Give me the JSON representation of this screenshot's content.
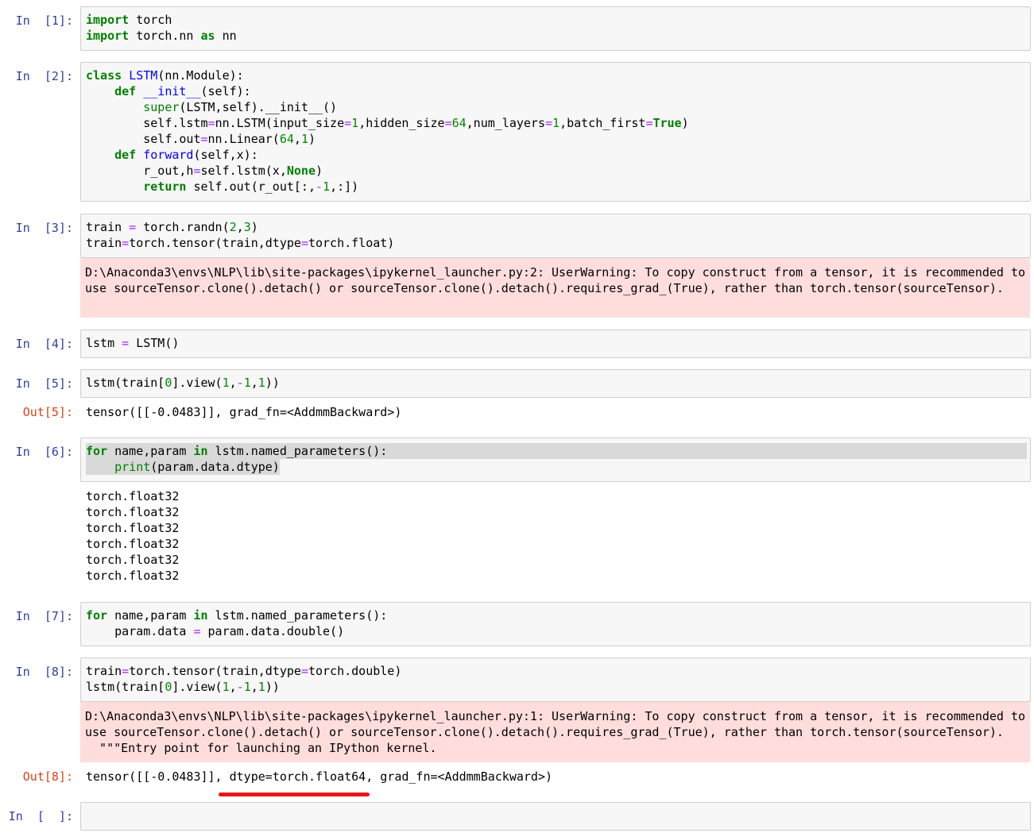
{
  "cells": [
    {
      "prompt": "In  [1]:",
      "lines": [
        "import torch",
        "import torch.nn as nn"
      ]
    },
    {
      "prompt": "In  [2]:",
      "lines": [
        "class LSTM(nn.Module):",
        "    def __init__(self):",
        "        super(LSTM,self).__init__()",
        "        self.lstm=nn.LSTM(input_size=1,hidden_size=64,num_layers=1,batch_first=True)",
        "        self.out=nn.Linear(64,1)",
        "    def forward(self,x):",
        "        r_out,h=self.lstm(x,None)",
        "        return self.out(r_out[:,-1,:])"
      ]
    },
    {
      "prompt": "In  [3]:",
      "lines": [
        "train = torch.randn(2,3)",
        "train=torch.tensor(train,dtype=torch.float)"
      ],
      "stderr": "D:\\Anaconda3\\envs\\NLP\\lib\\site-packages\\ipykernel_launcher.py:2: UserWarning: To copy construct from a tensor, it is recommended to\nuse sourceTensor.clone().detach() or sourceTensor.clone().detach().requires_grad_(True), rather than torch.tensor(sourceTensor)."
    },
    {
      "prompt": "In  [4]:",
      "lines": [
        "lstm = LSTM()"
      ]
    },
    {
      "prompt": "In  [5]:",
      "lines": [
        "lstm(train[0].view(1,-1,1))"
      ],
      "out_prompt": "Out[5]:",
      "out": "tensor([[-0.0483]], grad_fn=<AddmmBackward>)"
    },
    {
      "prompt": "In  [6]:",
      "lines": [
        "for name,param in lstm.named_parameters():",
        "    print(param.data.dtype)"
      ],
      "stdout": "torch.float32\ntorch.float32\ntorch.float32\ntorch.float32\ntorch.float32\ntorch.float32"
    },
    {
      "prompt": "In  [7]:",
      "lines": [
        "for name,param in lstm.named_parameters():",
        "    param.data = param.data.double()"
      ]
    },
    {
      "prompt": "In  [8]:",
      "lines": [
        "train=torch.tensor(train,dtype=torch.double)",
        "lstm(train[0].view(1,-1,1))"
      ],
      "stderr": "D:\\Anaconda3\\envs\\NLP\\lib\\site-packages\\ipykernel_launcher.py:1: UserWarning: To copy construct from a tensor, it is recommended to\nuse sourceTensor.clone().detach() or sourceTensor.clone().detach().requires_grad_(True), rather than torch.tensor(sourceTensor).\n  \"\"\"Entry point for launching an IPython kernel.",
      "out_prompt": "Out[8]:",
      "out": "tensor([[-0.0483]], dtype=torch.float64, grad_fn=<AddmmBackward>)"
    },
    {
      "prompt": "In  [  ]:",
      "lines": [
        ""
      ]
    }
  ],
  "annotation_color": "#e8171c"
}
